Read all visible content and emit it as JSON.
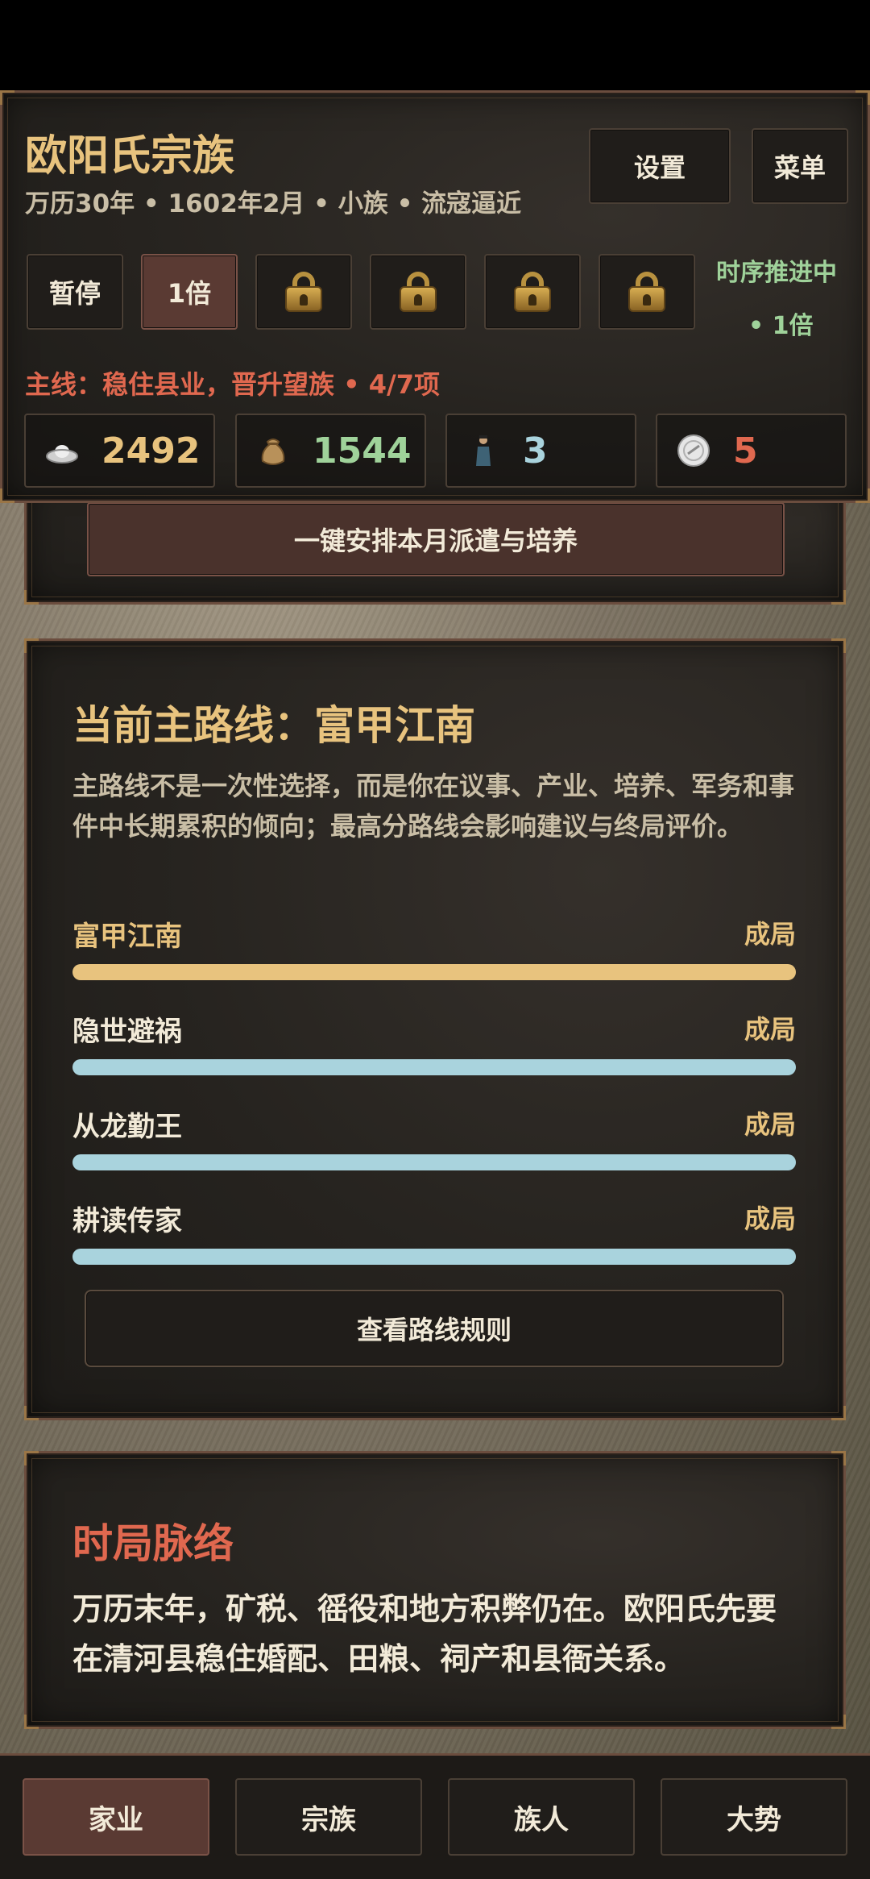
{
  "header": {
    "title": "欧阳氏宗族",
    "meta": "万历30年 • 1602年2月 • 小族 • 流寇逼近",
    "settings_label": "设置",
    "menu_label": "菜单",
    "speed_buttons": [
      "暂停",
      "1倍"
    ],
    "locked_speed_icons": [
      "lock-icon",
      "lock-icon",
      "lock-icon",
      "lock-icon"
    ],
    "status_line1": "时序推进中",
    "status_line2": "• 1倍",
    "mainline": "主线：稳住县业，晋升望族 • 4/7项"
  },
  "resources": [
    {
      "icon": "silver-ingot-icon",
      "value": "2492",
      "color": "#e8c37e"
    },
    {
      "icon": "grain-sack-icon",
      "value": "1544",
      "color": "#9fd29a"
    },
    {
      "icon": "clansman-icon",
      "value": "3",
      "color": "#a9d3dd"
    },
    {
      "icon": "reputation-coin-icon",
      "value": "5",
      "color": "#e0684f"
    }
  ],
  "partial_button": "一键安排本月派遣与培养",
  "route_panel": {
    "title": "当前主路线：富甲江南",
    "description": "主路线不是一次性选择，而是你在议事、产业、培养、军务和事件中长期累积的倾向；最高分路线会影响建议与终局评价。",
    "routes": [
      {
        "name": "富甲江南",
        "state": "成局",
        "color": "#e8c37e"
      },
      {
        "name": "隐世避祸",
        "state": "成局",
        "color": "#a9d3dd"
      },
      {
        "name": "从龙勤王",
        "state": "成局",
        "color": "#a9d3dd"
      },
      {
        "name": "耕读传家",
        "state": "成局",
        "color": "#a9d3dd"
      }
    ],
    "rules_button": "查看路线规则"
  },
  "situation_panel": {
    "title": "时局脉络",
    "text": "万历末年，矿税、徭役和地方积弊仍在。欧阳氏先要在清河县稳住婚配、田粮、祠产和县衙关系。"
  },
  "nav": [
    "家业",
    "宗族",
    "族人",
    "大势"
  ],
  "colors": {
    "gold": "#e8c37e",
    "red": "#e0684f",
    "green": "#9fd29a",
    "blue": "#a9d3dd"
  }
}
